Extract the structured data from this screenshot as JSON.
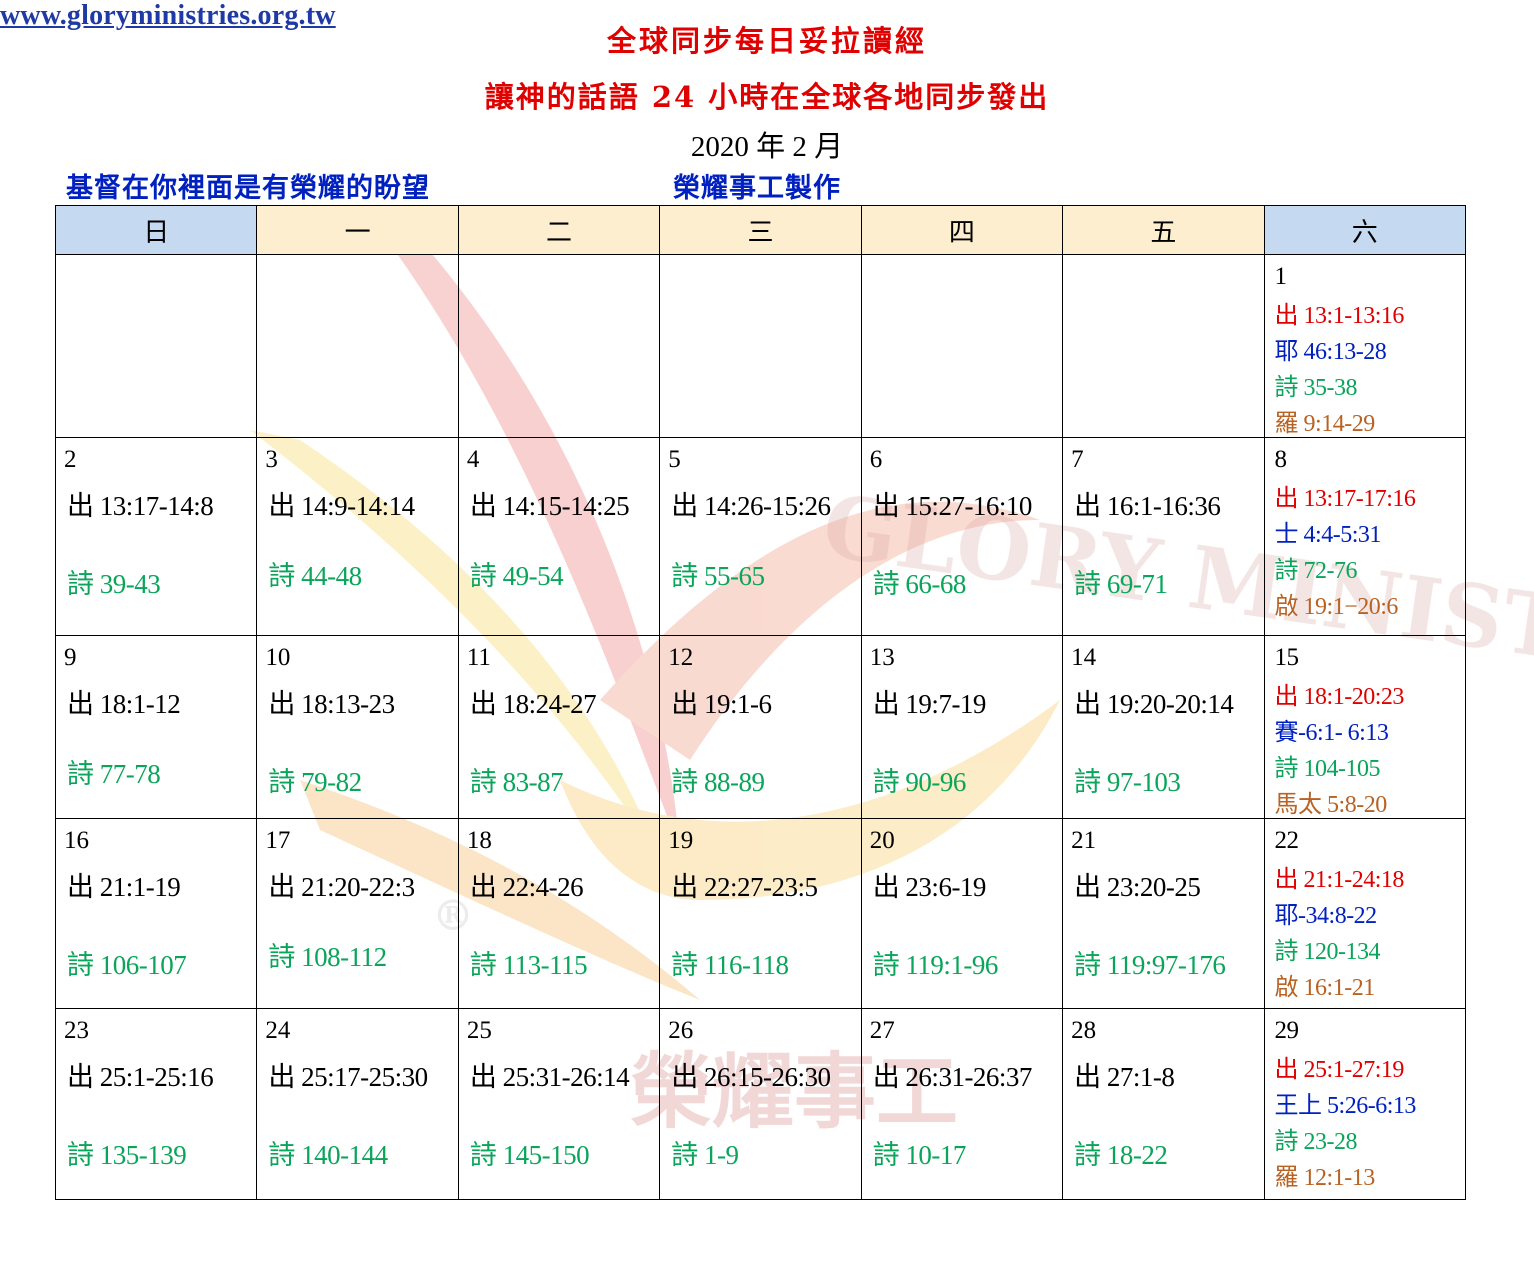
{
  "header": {
    "title1": "全球同步每日妥拉讀經",
    "title2": "讓神的話語 24 小時在全球各地同步發出",
    "month": "2020 年 2 月",
    "motto": "基督在你裡面是有榮耀的盼望",
    "maker": "榮耀事工製作",
    "url": "www.gloryministries.org.tw"
  },
  "weekdays": [
    "日",
    "一",
    "二",
    "三",
    "四",
    "五",
    "六"
  ],
  "weeks": [
    {
      "days": [
        null,
        null,
        null,
        null,
        null,
        null
      ],
      "saturday": {
        "day": "1",
        "torah": "出 13:1-13:16",
        "haftarah": "耶 46:13-28",
        "psalms": "詩  35-38",
        "nt": "羅 9:14-29"
      }
    },
    {
      "days": [
        {
          "day": "2",
          "reading": "出 13:17-14:8",
          "psalms": "詩  39-43"
        },
        {
          "day": "3",
          "reading": "出 14:9-14:14",
          "psalms": "詩  44-48"
        },
        {
          "day": "4",
          "reading": "出 14:15-14:25",
          "psalms": "詩  49-54"
        },
        {
          "day": "5",
          "reading": "出 14:26-15:26",
          "psalms": "詩  55-65"
        },
        {
          "day": "6",
          "reading": "出 15:27-16:10",
          "psalms": "詩  66-68"
        },
        {
          "day": "7",
          "reading": "出 16:1-16:36",
          "psalms": "詩  69-71"
        }
      ],
      "saturday": {
        "day": "8",
        "torah": "出 13:17-17:16",
        "haftarah": "士 4:4-5:31",
        "psalms": "詩  72-76",
        "nt": "啟 19:1−20:6"
      }
    },
    {
      "days": [
        {
          "day": "9",
          "reading": "出 18:1-12",
          "psalms": "詩  77-78"
        },
        {
          "day": "10",
          "reading": "出 18:13-23",
          "psalms": "詩  79-82"
        },
        {
          "day": "11",
          "reading": "出 18:24-27",
          "psalms": "詩  83-87"
        },
        {
          "day": "12",
          "reading": "出 19:1-6",
          "psalms": "詩  88-89"
        },
        {
          "day": "13",
          "reading": "出 19:7-19",
          "psalms": "詩  90-96"
        },
        {
          "day": "14",
          "reading": "出 19:20-20:14",
          "psalms": "詩  97-103"
        }
      ],
      "saturday": {
        "day": "15",
        "torah": "出 18:1-20:23",
        "haftarah": "賽-6:1- 6:13",
        "psalms": "詩  104-105",
        "nt": "馬太 5:8-20"
      }
    },
    {
      "days": [
        {
          "day": "16",
          "reading": "出 21:1-19",
          "psalms": "詩  106-107"
        },
        {
          "day": "17",
          "reading": "出 21:20-22:3",
          "psalms": "詩  108-112"
        },
        {
          "day": "18",
          "reading": "出 22:4-26",
          "psalms": "詩  113-115"
        },
        {
          "day": "19",
          "reading": "出 22:27-23:5",
          "psalms": "詩  116-118"
        },
        {
          "day": "20",
          "reading": "出 23:6-19",
          "psalms": "詩  119:1-96"
        },
        {
          "day": "21",
          "reading": "出 23:20-25",
          "psalms": "詩  119:97-176"
        }
      ],
      "saturday": {
        "day": "22",
        "torah": "出 21:1-24:18",
        "haftarah": "耶-34:8-22",
        "psalms": "詩 120-134",
        "nt": "啟 16:1-21"
      }
    },
    {
      "days": [
        {
          "day": "23",
          "reading": "出 25:1-25:16",
          "psalms": "詩  135-139"
        },
        {
          "day": "24",
          "reading": "出 25:17-25:30",
          "psalms": "詩  140-144"
        },
        {
          "day": "25",
          "reading": "出 25:31-26:14",
          "psalms": "詩  145-150"
        },
        {
          "day": "26",
          "reading": "出 26:15-26:30",
          "psalms": "詩  1-9"
        },
        {
          "day": "27",
          "reading": "出 26:31-26:37",
          "psalms": "詩  10-17"
        },
        {
          "day": "28",
          "reading": "出 27:1-8",
          "psalms": "詩 18-22"
        }
      ],
      "saturday": {
        "day": "29",
        "torah": "出 25:1-27:19",
        "haftarah": "王上 5:26-6:13",
        "psalms": "詩  23-28",
        "nt": "羅 12:1-13"
      }
    }
  ],
  "watermark": {
    "word": "GLORY MINISTRIES",
    "registered": "®",
    "chinese": "榮耀事工"
  },
  "colors": {
    "title": "#e00000",
    "subtitle": "#0020c0",
    "psalms": "#0aa55a",
    "haftarah": "#0020c0",
    "nt": "#b86224",
    "header_blue": "#c5d9f1",
    "header_tan": "#fdeecf"
  }
}
